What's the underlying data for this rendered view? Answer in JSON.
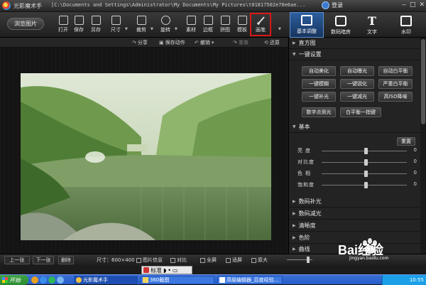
{
  "window": {
    "app_title": "光影魔术手",
    "path": "[C:\\Documents and Settings\\Administrator\\My Documents\\My Pictures\\t01817502e70e6ae...",
    "login_label": "登录",
    "controls": [
      "‒",
      "□",
      "✕"
    ]
  },
  "toolbar": {
    "browse_label": "浏览图片",
    "tools": [
      {
        "name": "open",
        "label": "打开"
      },
      {
        "name": "save",
        "label": "保存"
      },
      {
        "name": "save-as",
        "label": "另存"
      },
      {
        "name": "size",
        "label": "尺寸"
      },
      {
        "name": "crop",
        "label": "裁剪"
      },
      {
        "name": "rotate",
        "label": "旋转"
      },
      {
        "name": "material",
        "label": "素材"
      },
      {
        "name": "border",
        "label": "边框"
      },
      {
        "name": "collage",
        "label": "拼图"
      },
      {
        "name": "template",
        "label": "模板"
      },
      {
        "name": "brush",
        "label": "画笔"
      }
    ],
    "tabs": [
      {
        "name": "basic-adjust",
        "label": "基本调整",
        "active": true
      },
      {
        "name": "digital-darkroom",
        "label": "数码暗房",
        "active": false
      },
      {
        "name": "text",
        "label": "文字",
        "active": false
      },
      {
        "name": "watermark",
        "label": "水印",
        "active": false
      }
    ]
  },
  "subtoolbar": {
    "share": "分享",
    "save_action": "保存动作",
    "undo": "撤销",
    "redo": "重做",
    "restore": "还原"
  },
  "panel": {
    "histogram": "直方图",
    "one_click": {
      "title": "一键设置",
      "buttons": [
        [
          "自动美化",
          "自动曝光",
          "自动白平衡"
        ],
        [
          "一键模糊",
          "一键锐化",
          "严重白平衡"
        ],
        [
          "一键补光",
          "一键减光",
          "高ISO降噪"
        ],
        [
          "数字点测光",
          "白平衡一指键"
        ]
      ]
    },
    "basic": {
      "title": "基本",
      "reset": "重置",
      "sliders": [
        {
          "label": "亮度",
          "value": "0",
          "level": 0.5
        },
        {
          "label": "对比度",
          "value": "0",
          "level": 0.5
        },
        {
          "label": "色相",
          "value": "0",
          "level": 0.5
        },
        {
          "label": "饱和度",
          "value": "0",
          "level": 0.5
        }
      ]
    },
    "sections": [
      "数码补光",
      "数码减光",
      "清晰度",
      "色阶",
      "曲线"
    ]
  },
  "bottombar": {
    "prev": "上一张",
    "next": "下一张",
    "delete": "删除",
    "size": "尺寸：600×400",
    "image_info": "图片信息",
    "compare": "对比",
    "fullscreen": "全屏",
    "fit": "适屏",
    "original": "原大"
  },
  "ime": {
    "label": "标准"
  },
  "taskbar": {
    "start": "开始",
    "tasks": [
      "光影魔术手",
      "360截图",
      "高级编辑器_百度经验..."
    ],
    "clock": "10:55"
  },
  "watermark": {
    "text": "Bai经验",
    "url": "jingyan.baidu.com"
  },
  "colors": {
    "accent_tab": "#2c5f9e",
    "highlight_border": "#d91818",
    "taskbar": "#245cc8"
  }
}
